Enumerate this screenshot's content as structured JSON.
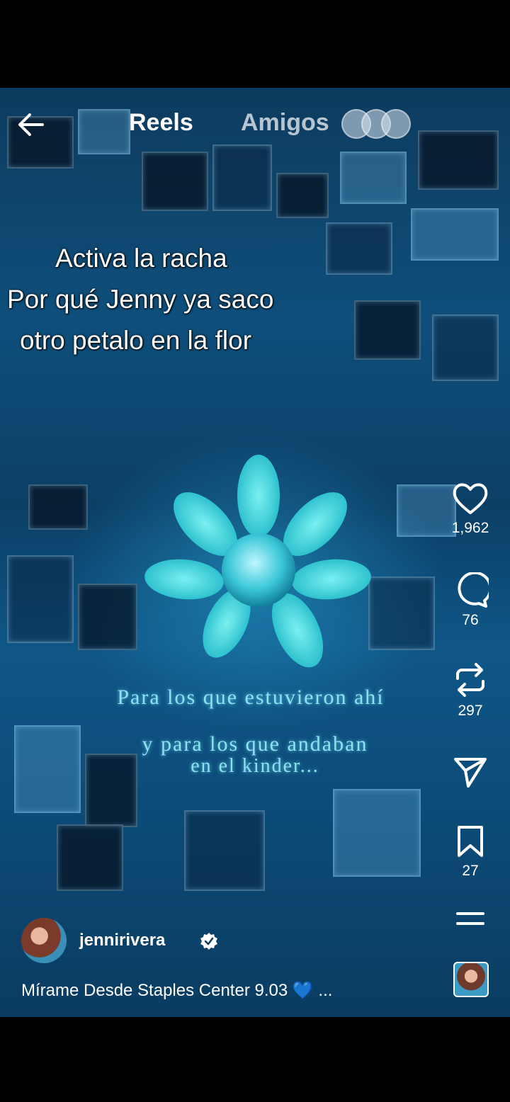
{
  "nav": {
    "back_icon": "arrow-left-icon",
    "tab_reels": "Reels",
    "tab_amigos": "Amigos"
  },
  "overlay": {
    "line1": "Activa la racha",
    "line2": "Por qué Jenny ya saco",
    "line3": "otro petalo en la flor"
  },
  "video_caption": {
    "line1": "Para los que estuvieron ahí",
    "line2": "y para los que andaban",
    "line3": "en el kinder..."
  },
  "actions": {
    "likes": "1,962",
    "comments": "76",
    "reposts": "297",
    "saves": "27",
    "icons": [
      "heart-icon",
      "comment-icon",
      "repost-icon",
      "share-icon",
      "bookmark-icon",
      "more-icon"
    ]
  },
  "author": {
    "username": "jennirivera",
    "verified": true
  },
  "description": {
    "text": "Mírame Desde Staples Center 9.03",
    "emoji": "💙",
    "more": "..."
  },
  "colors": {
    "accent": "#8de2f2",
    "flower": "#3fd6e0",
    "background": "#0f4f7c"
  }
}
